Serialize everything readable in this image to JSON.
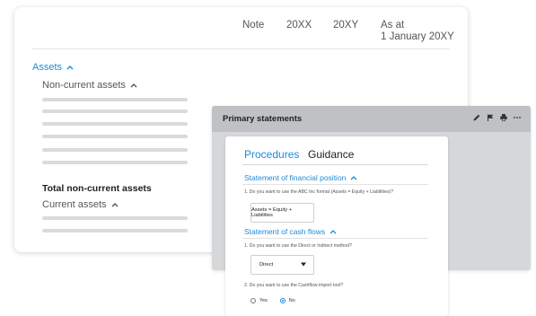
{
  "table_card": {
    "headers": {
      "note": "Note",
      "col_20xx": "20XX",
      "col_20xy": "20XY",
      "as_at_line1": "As at",
      "as_at_line2": "1 January 20XY"
    },
    "assets_label": "Assets",
    "non_current_label": "Non-current assets",
    "total_non_current_label": "Total non-current assets",
    "current_label": "Current assets"
  },
  "panel": {
    "title": "Primary statements",
    "icons": [
      "pencil-icon",
      "flag-icon",
      "print-icon",
      "more-icon"
    ]
  },
  "sheet": {
    "tabs": {
      "procedures": "Procedures",
      "guidance": "Guidance"
    },
    "section_financial_position": "Statement of financial position",
    "q1_financial_position": "1. Do you want to use the ABC Inc format (Assets = Equity + Liabilities)?",
    "format_button_label": "Assets = Equity + Liabilities",
    "section_cash_flows": "Statement of cash flows",
    "q1_cash_flows": "1. Do you want to use the Direct or Indirect method?",
    "method_select_value": "Direct",
    "q2_cash_flows": "2. Do you want to use the Cashflow import tool?",
    "radio_yes": "Yes",
    "radio_no": "No",
    "selected_radio": "No"
  },
  "colors": {
    "accent": "#1f8ad6",
    "panel_bg": "#d6d7d9",
    "panel_bar": "#bfc1c4",
    "skeleton": "#d9dadc"
  }
}
